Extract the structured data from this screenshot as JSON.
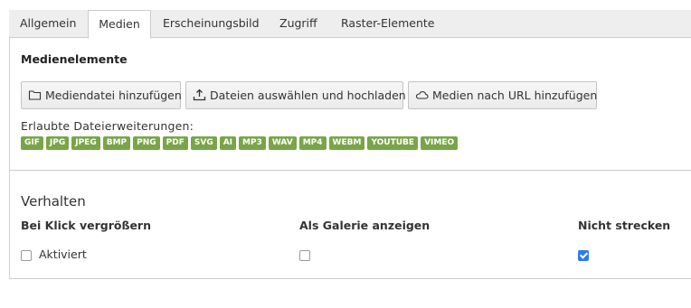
{
  "tabs": [
    {
      "label": "Allgemein",
      "active": false
    },
    {
      "label": "Medien",
      "active": true
    },
    {
      "label": "Erscheinungsbild",
      "active": false
    },
    {
      "label": "Zugriff",
      "active": false
    },
    {
      "label": "Raster-Elemente",
      "active": false
    }
  ],
  "media": {
    "title": "Medienelemente",
    "buttons": {
      "add_file": "Mediendatei hinzufügen",
      "upload": "Dateien auswählen und hochladen",
      "by_url": "Medien nach URL hinzufügen"
    },
    "allowed_label": "Erlaubte Dateierweiterungen:",
    "extensions": [
      "GIF",
      "JPG",
      "JPEG",
      "BMP",
      "PNG",
      "PDF",
      "SVG",
      "AI",
      "MP3",
      "WAV",
      "MP4",
      "WEBM",
      "YOUTUBE",
      "VIMEO"
    ],
    "badge_color": "#79a548"
  },
  "behavior": {
    "title": "Verhalten",
    "click_enlarge": {
      "label": "Bei Klick vergrößern",
      "option_label": "Aktiviert",
      "checked": false
    },
    "gallery": {
      "label": "Als Galerie anzeigen",
      "checked": false
    },
    "no_stretch": {
      "label": "Nicht strecken",
      "checked": true
    }
  },
  "colors": {
    "checkbox_checked": "#2b7de9"
  }
}
